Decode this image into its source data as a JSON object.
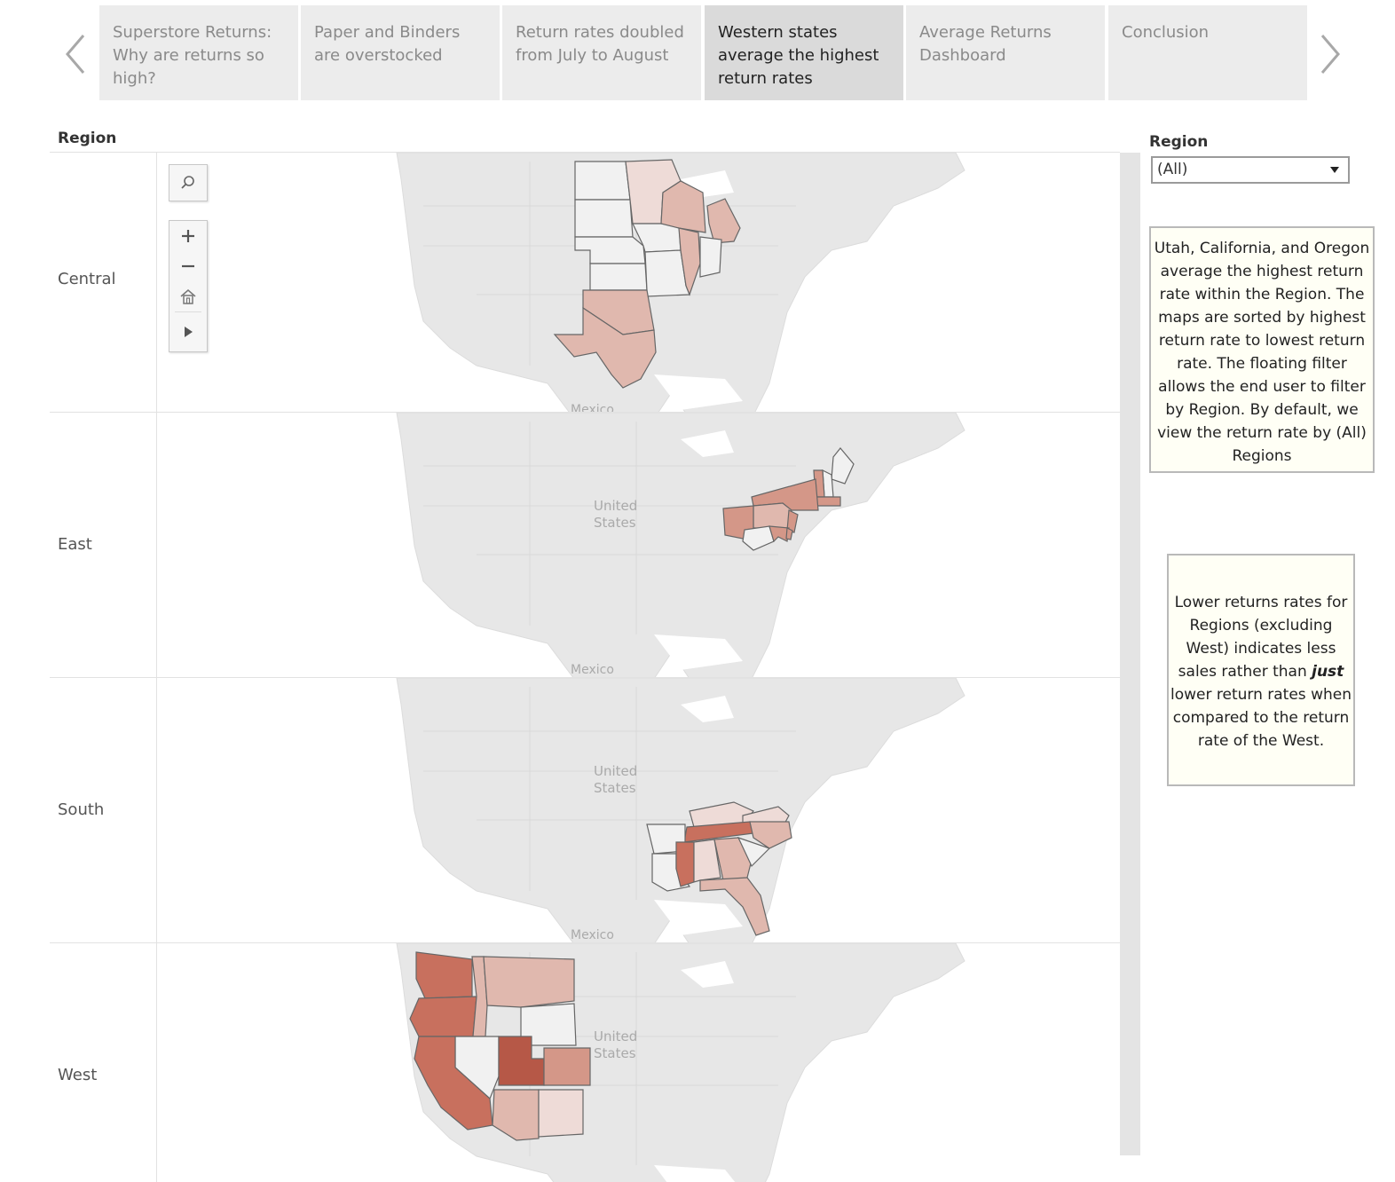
{
  "story_nav": {
    "prev_icon": "chevron-left-icon",
    "next_icon": "chevron-right-icon",
    "points": [
      {
        "label": "Superstore Returns: Why are returns so high?",
        "active": false
      },
      {
        "label": "Paper and Binders are overstocked",
        "active": false
      },
      {
        "label": "Return rates doubled from July to August",
        "active": false
      },
      {
        "label": "Western states average the highest return rates",
        "active": true
      },
      {
        "label": "Average Returns Dashboard",
        "active": false
      },
      {
        "label": "Conclusion",
        "active": false
      }
    ]
  },
  "map_panel": {
    "header": "Region",
    "basemap_labels": {
      "country": [
        "United",
        "States"
      ],
      "neighbor": "Mexico"
    },
    "tools": [
      "search-icon",
      "zoom-in-icon",
      "zoom-out-icon",
      "home-icon",
      "play-icon"
    ],
    "rows": [
      {
        "region": "Central",
        "states": [
          {
            "state": "North Dakota",
            "shade": "none"
          },
          {
            "state": "South Dakota",
            "shade": "none"
          },
          {
            "state": "Nebraska",
            "shade": "none"
          },
          {
            "state": "Kansas",
            "shade": "none"
          },
          {
            "state": "Minnesota",
            "shade": "very-light"
          },
          {
            "state": "Iowa",
            "shade": "none"
          },
          {
            "state": "Missouri",
            "shade": "none"
          },
          {
            "state": "Wisconsin",
            "shade": "light"
          },
          {
            "state": "Illinois",
            "shade": "light"
          },
          {
            "state": "Michigan",
            "shade": "light"
          },
          {
            "state": "Indiana",
            "shade": "none"
          },
          {
            "state": "Oklahoma",
            "shade": "light"
          },
          {
            "state": "Texas",
            "shade": "light"
          }
        ]
      },
      {
        "region": "East",
        "states": [
          {
            "state": "Maine",
            "shade": "none"
          },
          {
            "state": "New Hampshire",
            "shade": "none"
          },
          {
            "state": "Vermont",
            "shade": "medium"
          },
          {
            "state": "Massachusetts",
            "shade": "medium"
          },
          {
            "state": "New York",
            "shade": "medium"
          },
          {
            "state": "Pennsylvania",
            "shade": "light"
          },
          {
            "state": "Ohio",
            "shade": "medium"
          },
          {
            "state": "New Jersey",
            "shade": "medium"
          },
          {
            "state": "West Virginia",
            "shade": "none"
          },
          {
            "state": "Maryland",
            "shade": "medium"
          },
          {
            "state": "Delaware",
            "shade": "medium"
          }
        ]
      },
      {
        "region": "South",
        "states": [
          {
            "state": "Kentucky",
            "shade": "very-light"
          },
          {
            "state": "Virginia",
            "shade": "very-light"
          },
          {
            "state": "Tennessee",
            "shade": "dark"
          },
          {
            "state": "North Carolina",
            "shade": "light"
          },
          {
            "state": "Arkansas",
            "shade": "none"
          },
          {
            "state": "Louisiana",
            "shade": "none"
          },
          {
            "state": "Mississippi",
            "shade": "dark"
          },
          {
            "state": "Alabama",
            "shade": "very-light"
          },
          {
            "state": "Georgia",
            "shade": "light"
          },
          {
            "state": "South Carolina",
            "shade": "none"
          },
          {
            "state": "Florida",
            "shade": "light"
          }
        ]
      },
      {
        "region": "West",
        "states": [
          {
            "state": "Washington",
            "shade": "dark"
          },
          {
            "state": "Oregon",
            "shade": "dark"
          },
          {
            "state": "Idaho",
            "shade": "light"
          },
          {
            "state": "Montana",
            "shade": "light"
          },
          {
            "state": "Wyoming",
            "shade": "none"
          },
          {
            "state": "Nevada",
            "shade": "none"
          },
          {
            "state": "Utah",
            "shade": "darkest"
          },
          {
            "state": "Colorado",
            "shade": "medium"
          },
          {
            "state": "California",
            "shade": "dark"
          },
          {
            "state": "Arizona",
            "shade": "light"
          },
          {
            "state": "New Mexico",
            "shade": "very-light"
          }
        ]
      }
    ]
  },
  "colors": {
    "none": "#f1f1f1",
    "very-light": "#eedbd7",
    "light": "#e0b8ae",
    "medium": "#d49788",
    "dark": "#c8705e",
    "darkest": "#b65847",
    "land": "#e7e7e7",
    "water": "#f4f4f4",
    "state_border": "#666666"
  },
  "filter": {
    "title": "Region",
    "value": "(All)"
  },
  "captions": {
    "one": "Utah, California, and Oregon average the highest return rate within the Region. The maps are sorted by highest return rate to lowest return rate. The floating filter allows the end user to filter by Region. By default, we view the return rate by (All) Regions",
    "two_pre": "Lower returns rates for Regions (excluding West) indicates less sales rather than ",
    "two_em": "just",
    "two_post": " lower return rates when compared to the return rate of the West."
  }
}
